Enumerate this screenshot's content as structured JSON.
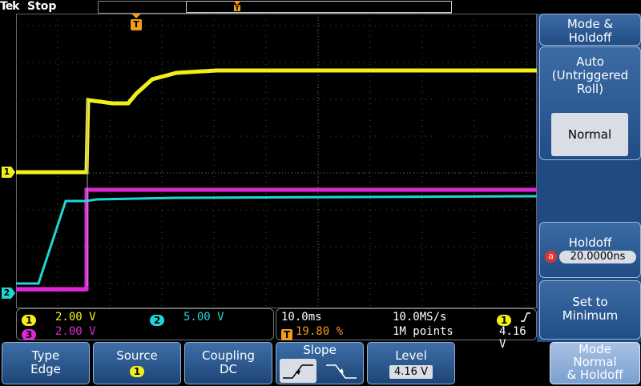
{
  "topbar": {
    "brand": "Tek",
    "run_state": "Stop",
    "trigger_marker": "T"
  },
  "channels": {
    "ch1_marker": "1",
    "ch2_marker": "2",
    "colors": {
      "ch1": "#f2ee1c",
      "ch2": "#20d4d8",
      "ch3": "#dc29d4",
      "trigger": "#f39c1c"
    }
  },
  "info_left": {
    "ch1_badge": "1",
    "ch1_scale": "2.00 V",
    "ch2_badge": "2",
    "ch2_scale": "5.00 V",
    "ch3_badge": "3",
    "ch3_scale": "2.00 V"
  },
  "info_right": {
    "time_scale": "10.0ms",
    "sample_rate": "10.0MS/s",
    "trig_badge": "1",
    "trig_slope_icon": "rising-edge-icon",
    "trig_icon": "T",
    "trig_position": "19.80 %",
    "record_length": "1M points",
    "trig_level": "4.16 V"
  },
  "bottom_menu": {
    "type_label": "Type",
    "type_value": "Edge",
    "source_label": "Source",
    "source_value": "1",
    "coupling_label": "Coupling",
    "coupling_value": "DC",
    "slope_label": "Slope",
    "level_label": "Level",
    "level_value": "4.16 V",
    "mode_label": "Mode",
    "mode_value_1": "Normal",
    "mode_value_2": "& Holdoff"
  },
  "side_menu": {
    "title_1": "Mode &",
    "title_2": "Holdoff",
    "auto_1": "Auto",
    "auto_2": "(Untriggered",
    "auto_3": "Roll)",
    "normal": "Normal",
    "holdoff_label": "Holdoff",
    "holdoff_knob": "a",
    "holdoff_value": "20.0000ns",
    "set_min_1": "Set to",
    "set_min_2": "Minimum"
  }
}
